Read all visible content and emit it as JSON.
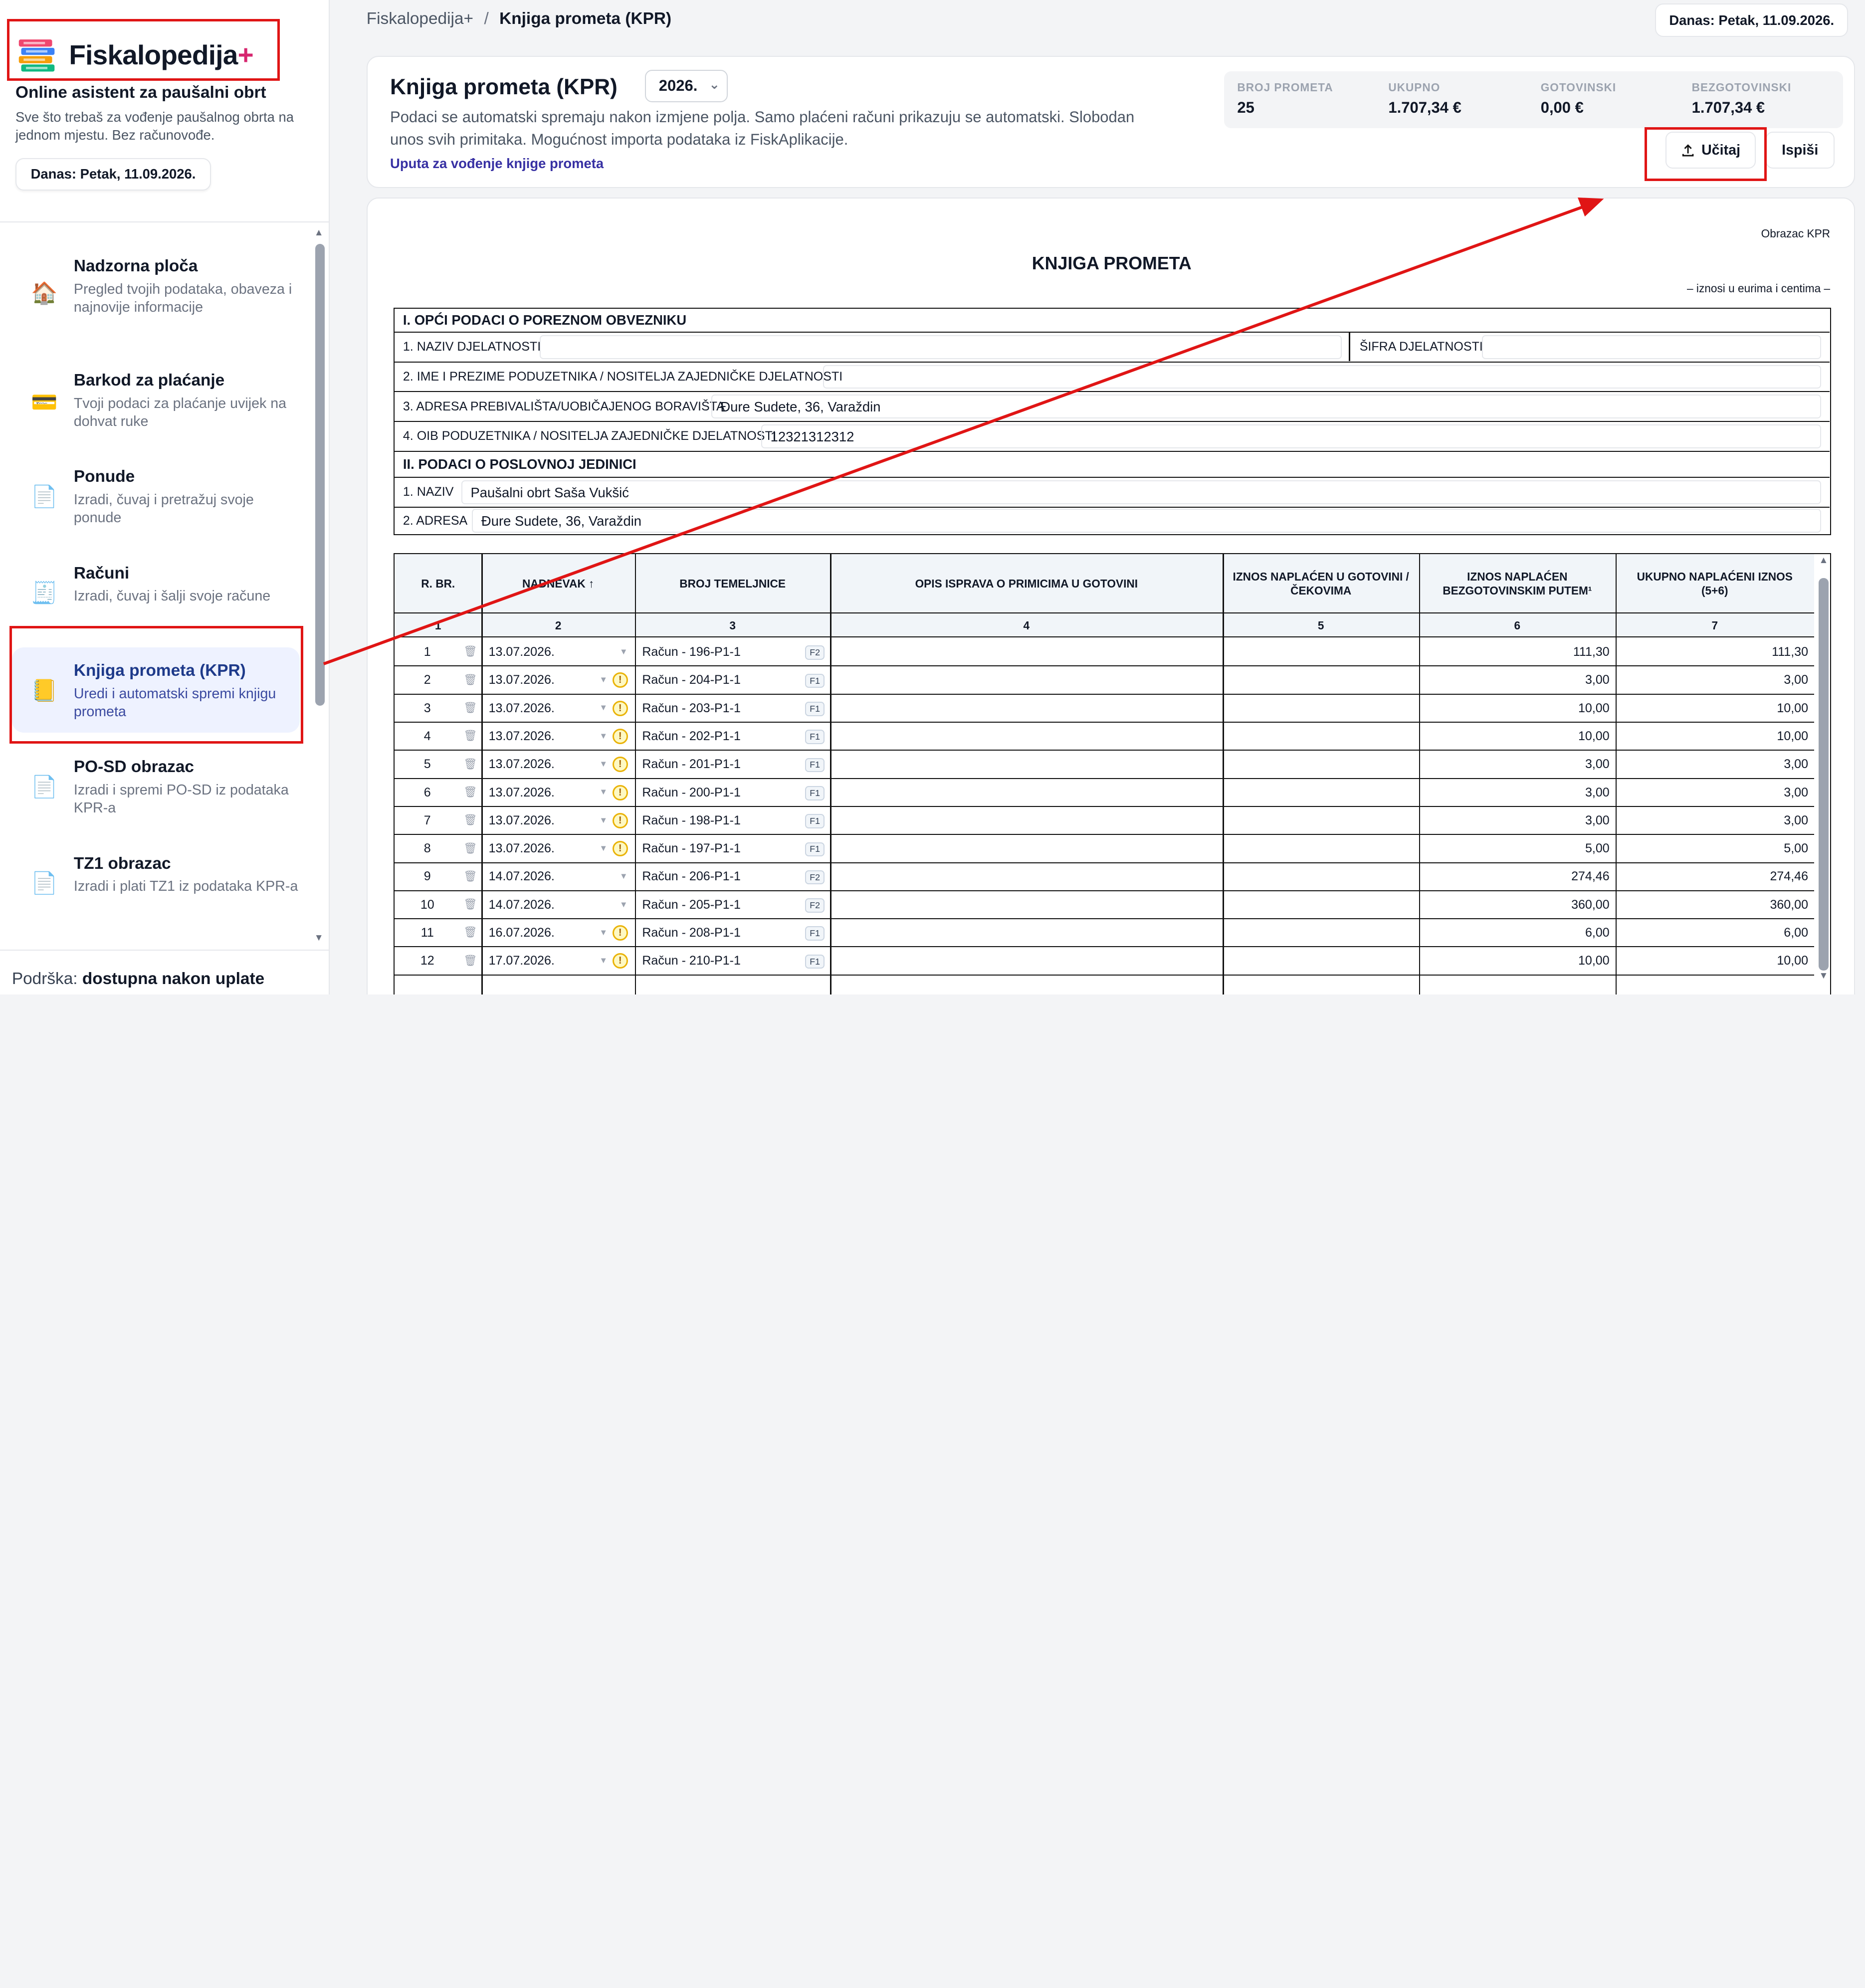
{
  "brand": {
    "name": "Fiskalopedija",
    "plus": "+",
    "tagline": "Online asistent za paušalni obrt",
    "description": "Sve što trebaš za vođenje paušalnog obrta na jednom mjestu. Bez računovođe."
  },
  "today": "Danas: Petak, 11.09.2026.",
  "nav": [
    {
      "title": "Nadzorna ploča",
      "desc": "Pregled tvojih podataka, obaveza i najnovije informacije",
      "icon": "home-icon"
    },
    {
      "title": "Barkod za plaćanje",
      "desc": "Tvoji podaci za plaćanje uvijek na dohvat ruke",
      "icon": "credit-card-icon"
    },
    {
      "title": "Ponude",
      "desc": "Izradi, čuvaj i pretražuj svoje ponude",
      "icon": "document-icon"
    },
    {
      "title": "Računi",
      "desc": "Izradi, čuvaj i šalji svoje račune",
      "icon": "receipt-icon"
    },
    {
      "title": "Knjiga prometa (KPR)",
      "desc": "Uredi i automatski spremi knjigu prometa",
      "icon": "ledger-icon"
    },
    {
      "title": "PO-SD obrazac",
      "desc": "Izradi i spremi PO-SD iz podataka KPR-a",
      "icon": "document-icon"
    },
    {
      "title": "TZ1 obrazac",
      "desc": "Izradi i plati TZ1 iz podataka KPR-a",
      "icon": "document-icon"
    }
  ],
  "support": {
    "label": "Podrška:",
    "value": "dostupna nakon uplate"
  },
  "breadcrumb": {
    "root": "Fiskalopedija+",
    "sep": "/",
    "current": "Knjiga prometa (KPR)"
  },
  "header": {
    "title": "Knjiga prometa (KPR)",
    "year": "2026.",
    "desc": "Podaci se automatski spremaju nakon izmjene polja. Samo plaćeni računi prikazuju se automatski. Slobodan unos svih primitaka. Mogućnost importa podataka iz FiskAplikacije.",
    "link": "Uputa za vođenje knjige prometa",
    "stats": [
      {
        "label": "BROJ PROMETA",
        "value": "25"
      },
      {
        "label": "UKUPNO",
        "value": "1.707,34 €"
      },
      {
        "label": "GOTOVINSKI",
        "value": "0,00 €"
      },
      {
        "label": "BEZGOTOVINSKI",
        "value": "1.707,34 €"
      }
    ],
    "upload_label": "Učitaj",
    "print_label": "Ispiši"
  },
  "form": {
    "obrazac": "Obrazac KPR",
    "title": "KNJIGA PROMETA",
    "iznosi": "– iznosi u eurima i centima –",
    "section1": "I. OPĆI PODACI O POREZNOM OBVEZNIKU",
    "naziv_djelatnosti": "1. NAZIV DJELATNOSTI",
    "sifra_djelatnosti": "ŠIFRA DJELATNOSTI",
    "ime_label": "2. IME I PREZIME PODUZETNIKA / NOSITELJA ZAJEDNIČKE DJELATNOSTI",
    "adresa_label": "3. ADRESA PREBIVALIŠTA/UOBIČAJENOG BORAVIŠTA",
    "adresa_value": "Đure Sudete, 36, Varaždin",
    "oib_label": "4. OIB PODUZETNIKA / NOSITELJA ZAJEDNIČKE DJELATNOSTI",
    "oib_value": "12321312312",
    "section2": "II. PODACI O POSLOVNOJ JEDINICI",
    "naziv_label": "1. NAZIV",
    "naziv_value": "Paušalni obrt Saša Vukšić",
    "adresa2_label": "2. ADRESA",
    "adresa2_value": "Đure Sudete, 36, Varaždin"
  },
  "ledger": {
    "columns": [
      {
        "label": "R. BR.",
        "num": "1"
      },
      {
        "label": "NADNEVAK ↑",
        "num": "2"
      },
      {
        "label": "BROJ TEMELJNICE",
        "num": "3"
      },
      {
        "label": "OPIS ISPRAVA O PRIMICIMA U GOTOVINI",
        "num": "4"
      },
      {
        "label": "IZNOS NAPLAĆEN U GOTOVINI / ČEKOVIMA",
        "num": "5"
      },
      {
        "label": "IZNOS NAPLAĆEN BEZGOTOVINSKIM PUTEM¹",
        "num": "6"
      },
      {
        "label": "UKUPNO NAPLAĆENI IZNOS (5+6)",
        "num": "7"
      }
    ],
    "rows": [
      {
        "rb": "1",
        "date": "13.07.2026.",
        "doc": "Račun - 196-P1-1",
        "tag": "F2",
        "warn": false,
        "bez": "111,30",
        "uk": "111,30"
      },
      {
        "rb": "2",
        "date": "13.07.2026.",
        "doc": "Račun - 204-P1-1",
        "tag": "F1",
        "warn": true,
        "bez": "3,00",
        "uk": "3,00"
      },
      {
        "rb": "3",
        "date": "13.07.2026.",
        "doc": "Račun - 203-P1-1",
        "tag": "F1",
        "warn": true,
        "bez": "10,00",
        "uk": "10,00"
      },
      {
        "rb": "4",
        "date": "13.07.2026.",
        "doc": "Račun - 202-P1-1",
        "tag": "F1",
        "warn": true,
        "bez": "10,00",
        "uk": "10,00"
      },
      {
        "rb": "5",
        "date": "13.07.2026.",
        "doc": "Račun - 201-P1-1",
        "tag": "F1",
        "warn": true,
        "bez": "3,00",
        "uk": "3,00"
      },
      {
        "rb": "6",
        "date": "13.07.2026.",
        "doc": "Račun - 200-P1-1",
        "tag": "F1",
        "warn": true,
        "bez": "3,00",
        "uk": "3,00"
      },
      {
        "rb": "7",
        "date": "13.07.2026.",
        "doc": "Račun - 198-P1-1",
        "tag": "F1",
        "warn": true,
        "bez": "3,00",
        "uk": "3,00"
      },
      {
        "rb": "8",
        "date": "13.07.2026.",
        "doc": "Račun - 197-P1-1",
        "tag": "F1",
        "warn": true,
        "bez": "5,00",
        "uk": "5,00"
      },
      {
        "rb": "9",
        "date": "14.07.2026.",
        "doc": "Račun - 206-P1-1",
        "tag": "F2",
        "warn": false,
        "bez": "274,46",
        "uk": "274,46"
      },
      {
        "rb": "10",
        "date": "14.07.2026.",
        "doc": "Račun - 205-P1-1",
        "tag": "F2",
        "warn": false,
        "bez": "360,00",
        "uk": "360,00"
      },
      {
        "rb": "11",
        "date": "16.07.2026.",
        "doc": "Račun - 208-P1-1",
        "tag": "F1",
        "warn": true,
        "bez": "6,00",
        "uk": "6,00"
      },
      {
        "rb": "12",
        "date": "17.07.2026.",
        "doc": "Račun - 210-P1-1",
        "tag": "F1",
        "warn": true,
        "bez": "10,00",
        "uk": "10,00"
      }
    ]
  },
  "colors": {
    "accent": "#3730a3",
    "annotation": "#e01515",
    "brand_plus": "#d6266f",
    "warning": "#eab308"
  }
}
